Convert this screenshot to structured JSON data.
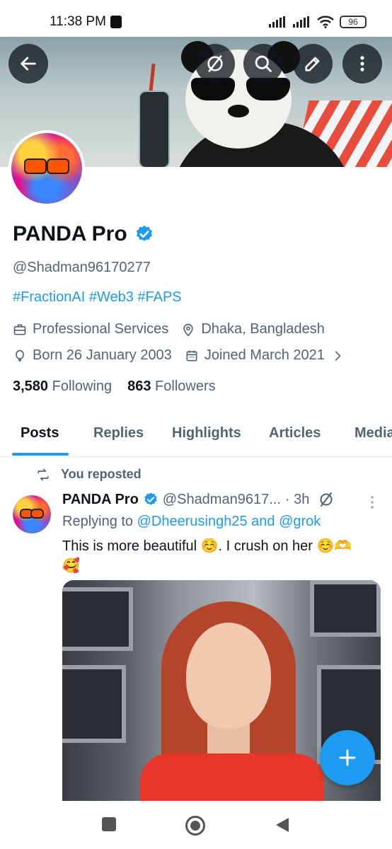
{
  "status_bar": {
    "time": "11:38 PM",
    "battery": "96"
  },
  "header": {
    "back_label": "Back",
    "actions": [
      "grok-icon",
      "search-icon",
      "edit-icon",
      "more-vertical-icon"
    ]
  },
  "profile": {
    "display_name": "PANDA Pro",
    "verified": true,
    "handle": "@Shadman96170277",
    "bio": "#FractionAI #Web3 #FAPS",
    "category": "Professional Services",
    "location": "Dhaka, Bangladesh",
    "born": "Born 26 January 2003",
    "joined": "Joined March 2021",
    "following_count": "3,580",
    "following_label": "Following",
    "followers_count": "863",
    "followers_label": "Followers"
  },
  "tabs": [
    {
      "label": "Posts",
      "active": true
    },
    {
      "label": "Replies",
      "active": false
    },
    {
      "label": "Highlights",
      "active": false
    },
    {
      "label": "Articles",
      "active": false
    },
    {
      "label": "Media",
      "active": false
    }
  ],
  "post": {
    "repost_label": "You reposted",
    "author_name": "PANDA Pro",
    "author_handle": "@Shadman9617...",
    "time": "· 3h",
    "replying_prefix": "Replying to",
    "replying_to": "@Dheerusingh25 and @grok",
    "text_line1": "This is more beautiful ☺️. I crush on her ☺️🫶",
    "text_line2": "🥰"
  },
  "colors": {
    "accent": "#1d9bf0",
    "text_primary": "#0f1419",
    "text_secondary": "#536471"
  }
}
